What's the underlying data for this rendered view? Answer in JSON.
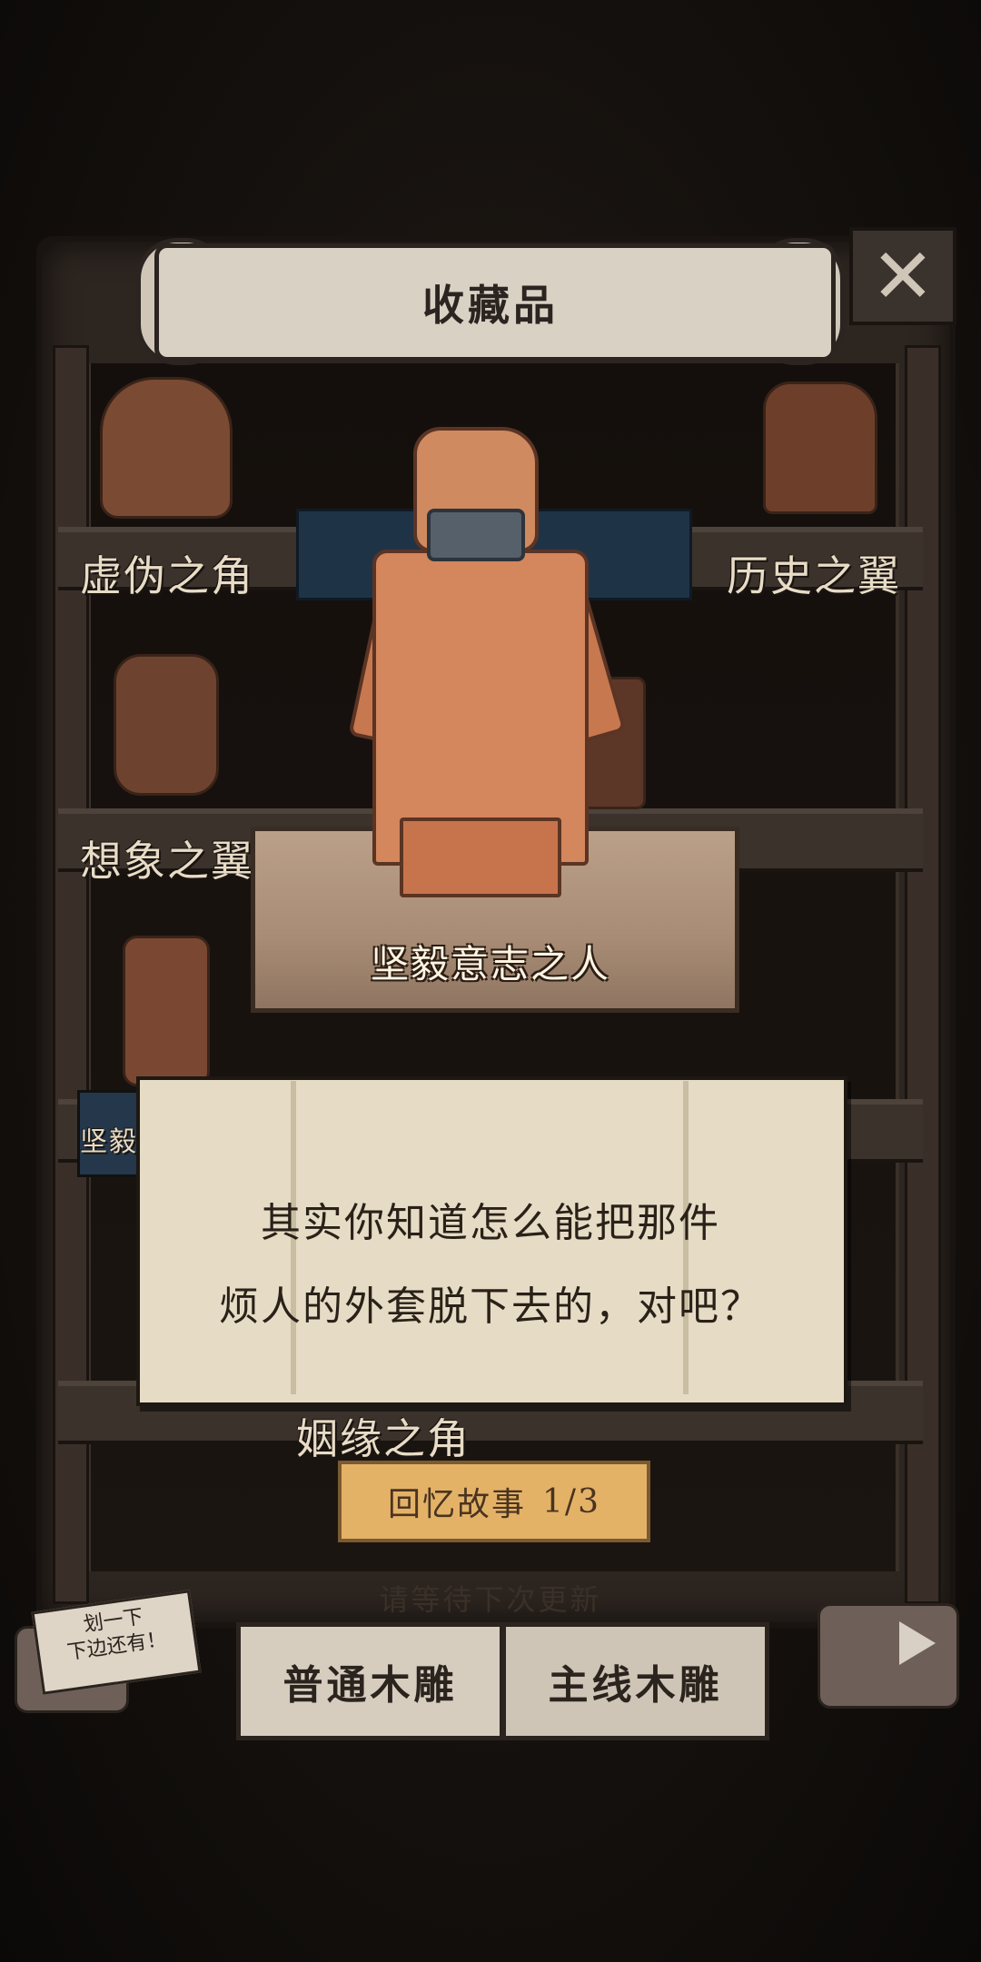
{
  "header": {
    "title": "收藏品",
    "close_icon": "close-x-icon"
  },
  "shelves": {
    "labels": [
      "虚伪之角",
      "历史之翼",
      "想象之翼",
      "坚毅",
      "姻缘之角"
    ]
  },
  "featured": {
    "name": "坚毅意志之人"
  },
  "note": {
    "line1": "其实你知道怎么能把那件",
    "line2": "烦人的外套脱下去的，对吧？"
  },
  "story_button": {
    "label": "回忆故事",
    "progress": "1/3"
  },
  "update_notice": "请等待下次更新",
  "scroll_hint": {
    "line1": "划一下",
    "line2": "下边还有！"
  },
  "tabs": [
    {
      "label": "普通木雕"
    },
    {
      "label": "主线木雕"
    }
  ],
  "colors": {
    "paper": "#e6dcc6",
    "story_button": "#e4b267",
    "wood_statue": "#d4865c",
    "background": "#15110e"
  }
}
